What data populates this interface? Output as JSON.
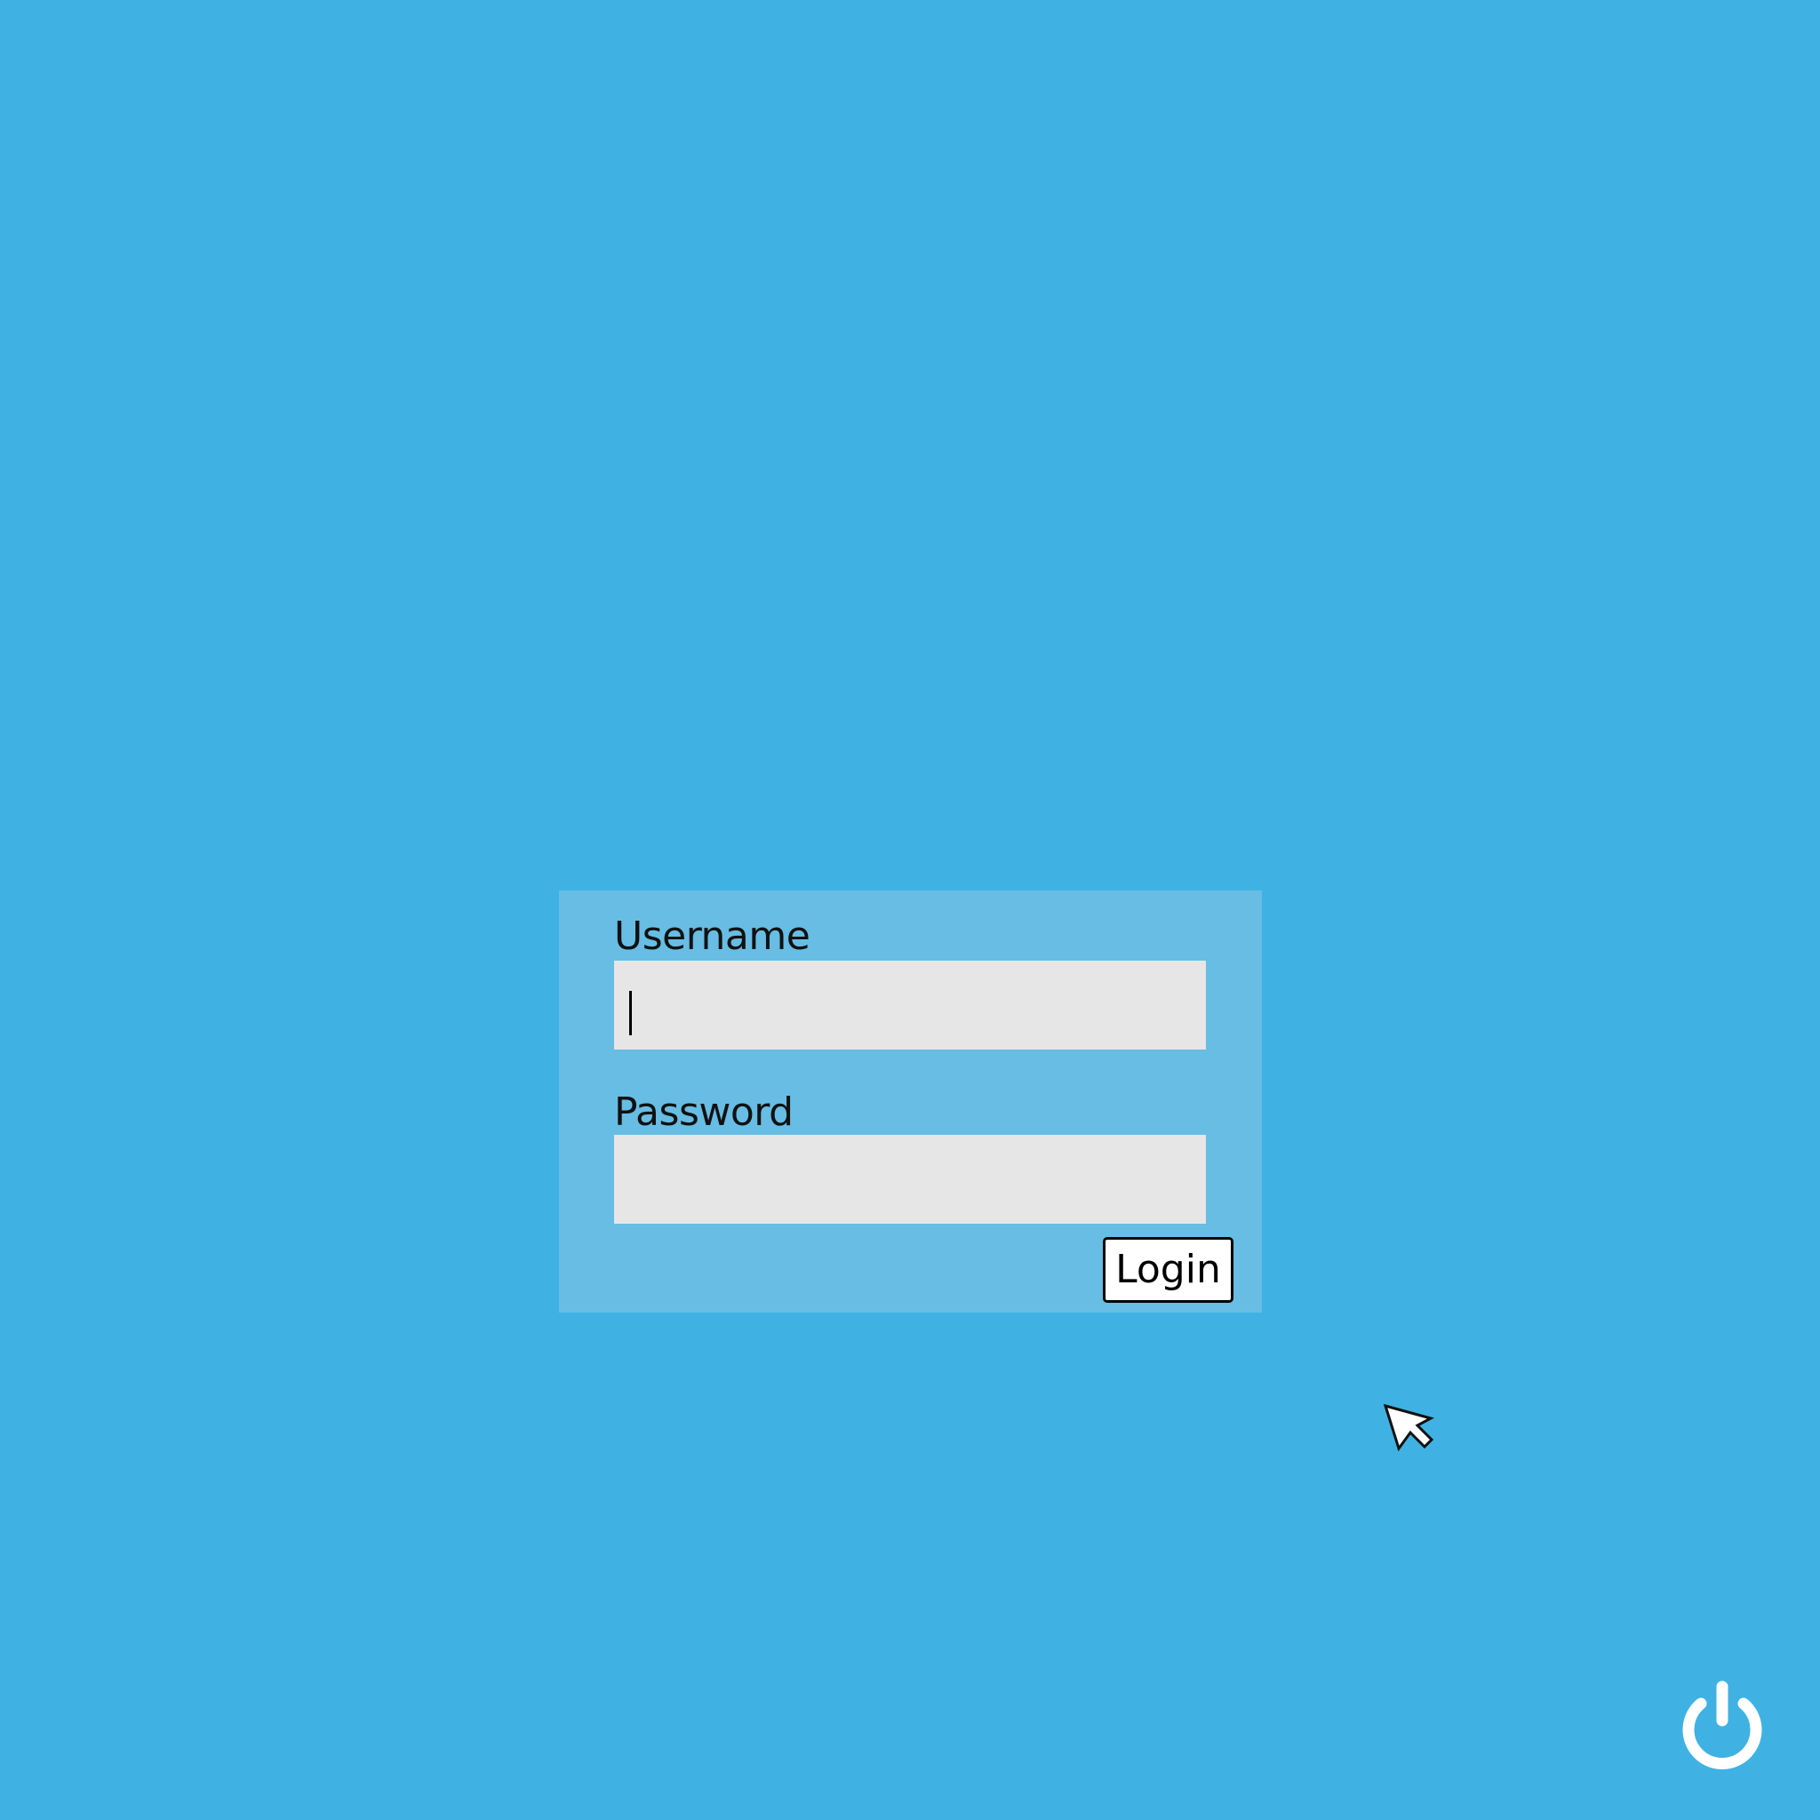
{
  "colors": {
    "desktop_background": "#3fb2e3",
    "panel_background": "#67bde3",
    "field_background": "#e7e6e7",
    "button_background": "#ffffff",
    "text": "#111111",
    "power_icon": "#ffffff"
  },
  "login_form": {
    "username_label": "Username",
    "username_value": "",
    "password_label": "Password",
    "password_value": "",
    "focused_field": "username",
    "login_button_label": "Login"
  },
  "icons": {
    "power": "power-icon",
    "cursor": "mouse-pointer-icon"
  }
}
